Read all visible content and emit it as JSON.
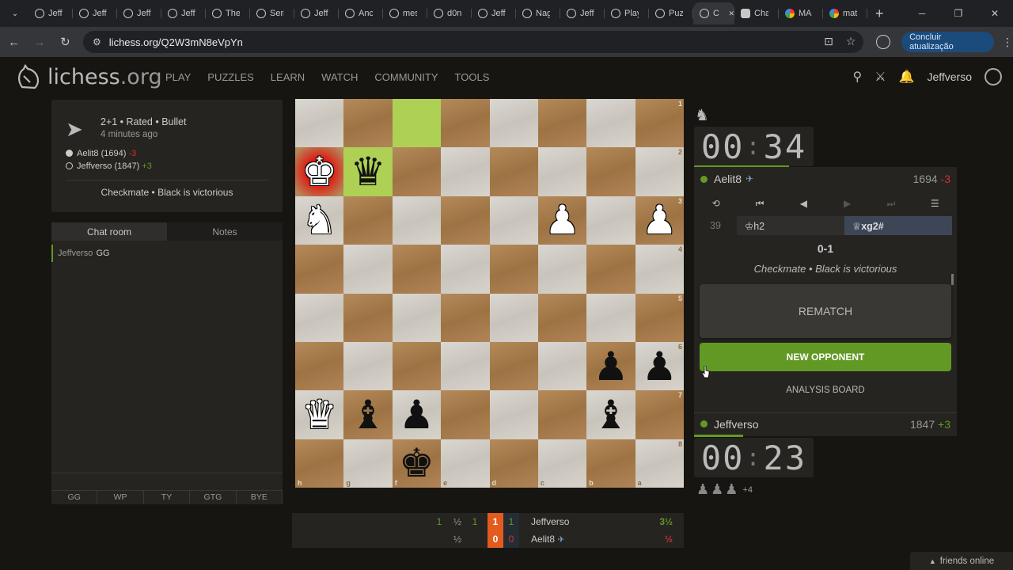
{
  "browser": {
    "tabs": [
      {
        "label": "Jeff",
        "favicon": "lichess"
      },
      {
        "label": "Jeff",
        "favicon": "lichess"
      },
      {
        "label": "Jeff",
        "favicon": "lichess"
      },
      {
        "label": "Jeff",
        "favicon": "lichess"
      },
      {
        "label": "The",
        "favicon": "lichess"
      },
      {
        "label": "Seri",
        "favicon": "lichess"
      },
      {
        "label": "Jeff",
        "favicon": "lichess"
      },
      {
        "label": "Anc",
        "favicon": "lichess"
      },
      {
        "label": "mes",
        "favicon": "lichess"
      },
      {
        "label": "d0n",
        "favicon": "lichess"
      },
      {
        "label": "Jeff",
        "favicon": "lichess"
      },
      {
        "label": "Nag",
        "favicon": "lichess"
      },
      {
        "label": "Jeff",
        "favicon": "lichess"
      },
      {
        "label": "Play",
        "favicon": "lichess"
      },
      {
        "label": "Puz",
        "favicon": "lichess"
      },
      {
        "label": "C",
        "favicon": "lichess",
        "active": true
      },
      {
        "label": "Cha",
        "favicon": "openai"
      },
      {
        "label": "MA",
        "favicon": "google"
      },
      {
        "label": "mat",
        "favicon": "google"
      }
    ],
    "url": "lichess.org/Q2W3mN8eVpYn",
    "update_label": "Concluir atualização"
  },
  "site": {
    "logo_main": "lichess",
    "logo_tld": ".org",
    "nav": [
      "PLAY",
      "PUZZLES",
      "LEARN",
      "WATCH",
      "COMMUNITY",
      "TOOLS"
    ],
    "username": "Jeffverso"
  },
  "game_meta": {
    "setup": "2+1 • Rated • Bullet",
    "ago": "4 minutes ago",
    "white_player": "Aelit8",
    "white_rating": "(1694)",
    "white_diff": "-3",
    "black_player": "Jeffverso",
    "black_rating": "(1847)",
    "black_diff": "+3",
    "status": "Checkmate • Black is victorious"
  },
  "chat": {
    "tab_chat": "Chat room",
    "tab_notes": "Notes",
    "messages": [
      {
        "user": "Jeffverso",
        "text": "GG"
      }
    ],
    "presets": [
      "GG",
      "WP",
      "TY",
      "GTG",
      "BYE"
    ]
  },
  "board": {
    "orientation": "black",
    "ranks": [
      "1",
      "2",
      "3",
      "4",
      "5",
      "6",
      "7",
      "8"
    ],
    "files": [
      "h",
      "g",
      "f",
      "e",
      "d",
      "c",
      "b",
      "a"
    ],
    "pieces": [
      [
        "",
        "",
        "",
        "",
        "",
        "",
        "",
        ""
      ],
      [
        "wK",
        "bQ",
        "",
        "",
        "",
        "",
        "",
        ""
      ],
      [
        "wN",
        "",
        "",
        "",
        "",
        "wP",
        "",
        "wP"
      ],
      [
        "",
        "",
        "",
        "",
        "",
        "",
        "",
        ""
      ],
      [
        "",
        "",
        "",
        "",
        "",
        "",
        "",
        ""
      ],
      [
        "",
        "",
        "",
        "",
        "",
        "",
        "bP",
        "bP"
      ],
      [
        "wQ",
        "bB",
        "bP",
        "",
        "",
        "",
        "bB",
        ""
      ],
      [
        "",
        "",
        "bK",
        "",
        "",
        "",
        "",
        ""
      ]
    ],
    "last_move_from": "f1",
    "last_move_to": "g2",
    "check_square": "h2"
  },
  "clocks": {
    "top_min": "00",
    "top_sec": "34",
    "bottom_min": "00",
    "bottom_sec": "23"
  },
  "right_panel": {
    "top_player": "Aelit8",
    "top_rating": "1694",
    "top_diff": "-3",
    "move_number": "39",
    "white_move": "♔h2",
    "black_move": "♕xg2#",
    "result": "0-1",
    "result_status": "Checkmate • Black is victorious",
    "rematch_label": "REMATCH",
    "new_opponent_label": "NEW OPPONENT",
    "analysis_label": "ANALYSIS BOARD",
    "bottom_player": "Jeffverso",
    "bottom_rating": "1847",
    "bottom_diff": "+3",
    "material_plus": "+4"
  },
  "crosstable": {
    "row1": {
      "c1": "1",
      "c2": "½",
      "c3": "1",
      "box1": "1",
      "box2": "1",
      "name": "Jeffverso",
      "score": "3½"
    },
    "row2": {
      "c2": "½",
      "box1": "0",
      "box2": "0",
      "name": "Aelit8",
      "score": "½"
    }
  },
  "footer": {
    "friends": "friends online"
  },
  "colors": {
    "accent_green": "#629924",
    "loss_red": "#cc3333",
    "board_light": "#dad7d2",
    "board_dark": "#b48a5b"
  }
}
